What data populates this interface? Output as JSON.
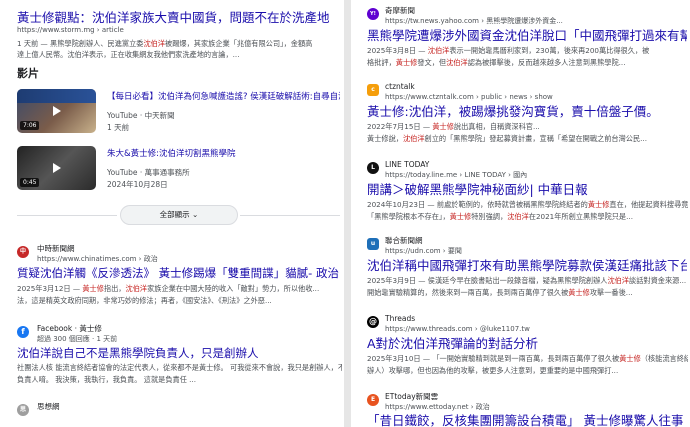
{
  "left": {
    "r1": {
      "title": "黃士修觀點：沈伯洋家族大賣中國貨，問題不在於洗產地",
      "url": "https://www.storm.mg › article",
      "date": "1 天前",
      "snip1a": "— 黑熊學院創辦人、民進黨立委",
      "snip1hl": "沈伯洋",
      "snip1b": "被踢爆，其家族企業「兆億有限公司」，金額高",
      "snip2": "達上億人民幣。沈伯洋表示，正在收集網友我他們家洗產地的言論，..."
    },
    "videos_heading": "影片",
    "v1": {
      "title": "【每日必看】沈伯洋為何急喊護造謠? 侯漢廷破解話術:自尋自演",
      "source": "YouTube · 中天新聞",
      "date": "1 天前",
      "duration": "7:06"
    },
    "v2": {
      "title": "朱大&黃士修:沈伯洋切割黑熊學院",
      "source": "YouTube · 萬事通事務所",
      "date": "2024年10月28日",
      "duration": "0:45"
    },
    "show_all": "全部顯示",
    "r2": {
      "site": "中時新聞網",
      "url": "https://www.chinatimes.com › 政治",
      "title": "質疑沈伯洋觸《反滲透法》 黃士修踢爆「雙重間諜」貓膩- 政治",
      "snip1a": "2025年3月12日 — ",
      "snip1hl": "黃士修",
      "snip1b": "指出，",
      "snip1hl2": "沈伯洋",
      "snip1c": "家族企業在中國大陸的收入「敵對」勢力，所以他收...",
      "snip2": "法，這是精英文政府同期，非常巧妙的修法；再者，《國安法》、《刑法》之外惡..."
    },
    "r3": {
      "site": "Facebook · 黃士修",
      "url": "超過 300 個回應 · 1 天前",
      "title": "沈伯洋說自己不是黑熊學院負責人，只是創辦人",
      "snip1": "社團法人核 能流言終結者協會的法定代表人，從來都不是黃士修。 可我從來不會說，我只是創辦人，不",
      "snip2": "負責人唷。 我決策，我執行，我負責。 這就是負責任 ..."
    },
    "r4": {
      "site": "思想網"
    }
  },
  "right": {
    "r1": {
      "site": "奇摩新聞",
      "url": "https://tw.news.yahoo.com › 黑熊學院遭爆涉外資金...",
      "title": "黑熊學院遭爆涉外國資金沈伯洋脫口「中國飛彈打過來有幫助」",
      "snip1a": "2025年3月8日 — ",
      "snip1hl": "沈伯洋",
      "snip1b": "表示一開始靠馬曆利家到，230萬，後來再200萬比得很久，被",
      "snip2a": "格批評，",
      "snip2hl": "黃士修",
      "snip2b": "發文，但",
      "snip2hl2": "沈伯洋",
      "snip2c": "認為被揮擊後，反而越來越多人注意到黑熊學院..."
    },
    "r2": {
      "site": "ctzntalk",
      "url": "https://www.ctzntalk.com › public › news › show",
      "title": "黃士修:沈伯洋，被踢爆挑發沟寶貨，賣十倍盤子價。",
      "snip1a": "2022年7月15日 — ",
      "snip1hl": "黃士修",
      "snip1b": "說出真相，自稱資深科官...",
      "snip2a": "黃士修說，",
      "snip2hl": "沈伯洋",
      "snip2b": "創立的「黑熊學院」發起募資計畫，宣稱「希望在開戰之前台灣公民..."
    },
    "r3": {
      "site": "LINE TODAY",
      "url": "https://today.line.me › LINE TODAY › 國內",
      "title": "開講＞破解黑熊學院神秘面紗| 中華日報",
      "snip1a": "2024年10月23日 — 前處於範例的，依時就曾被稱黑熊學院終結者的",
      "snip1hl": "黃士修",
      "snip1b": "直在，他提起資料搜尋竟然發現",
      "snip2a": "「黑熊學院根本不存在」，",
      "snip2hl": "黃士修",
      "snip2b": "特別強調，",
      "snip2hl2": "沈伯洋",
      "snip2c": "在2021年所創立黑熊學院只是..."
    },
    "r4": {
      "site": "聯合新聞網",
      "url": "https://udn.com › 要聞",
      "title": "沈伯洋稱中國飛彈打來有助黑熊學院募款侯漢廷痛批該下台 ...",
      "snip1a": "2025年3月9日 — 侯漢廷今早在臉書貼出一段錄音檔，疑為黑熊學院創辦人",
      "snip1hl": "沈伯洋",
      "snip1b": "談話對資金來源...",
      "snip2a": "開始靠實驗精算的，然後來到一兩百萬，長到兩百萬停了很久被",
      "snip2hl": "黃士修",
      "snip2b": "攻擊一番後..."
    },
    "r5": {
      "site": "Threads",
      "url": "https://www.threads.com › @luke1107.tw",
      "title": "A對於沈伯洋飛彈論的對話分析",
      "snip1a": "2025年3月10日 — 「一開始實驗精到就是到一兩百萬，長到兩百萬停了很久被",
      "snip1hl": "黃士修",
      "snip1b": "（核能流言終結者創",
      "snip2": "辦人）攻擊哪，但也因為他的攻擊，被更多人注意到，更重要的是中國飛彈打..."
    },
    "r6": {
      "site": "ETtoday新聞雲",
      "url": "https://www.ettoday.net › 政治",
      "title": "「昔日鐵餃，反核集團開籌設台積電」 黃士修曝驚人往事"
    }
  },
  "colors": {
    "link": "#1a0dab",
    "highlight": "#c5221f",
    "chinatimes": "#c62828",
    "facebook": "#1877f2",
    "yahoo": "#5f01d1",
    "ctzntalk": "#f59e0b",
    "linetoday": "#111111",
    "udn": "#1e6fb8",
    "threads": "#000000",
    "ettoday": "#e8531f"
  }
}
